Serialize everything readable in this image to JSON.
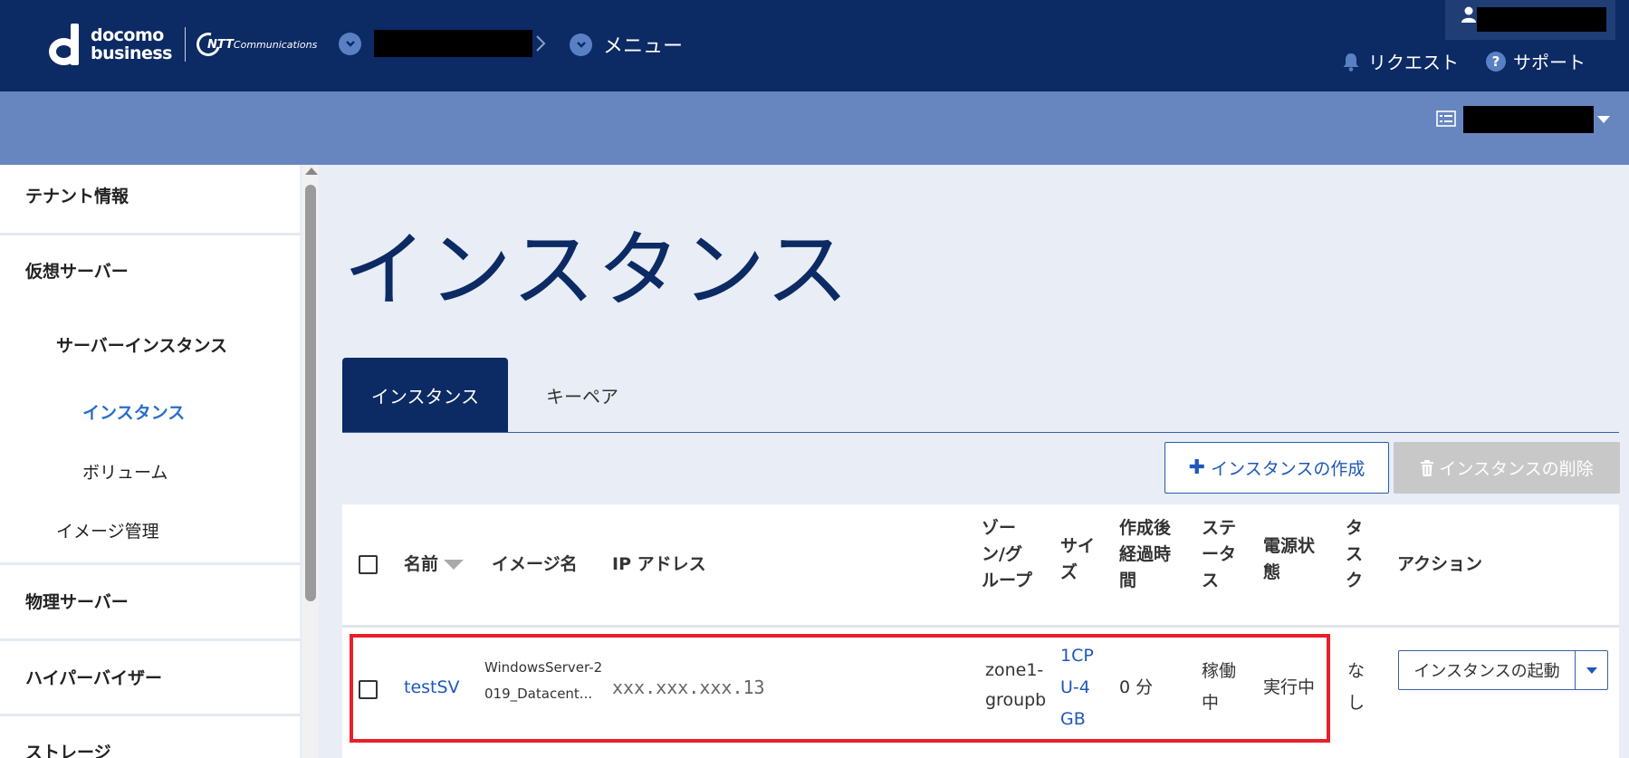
{
  "brand": {
    "logo_top": "docomo",
    "logo_bottom": "business",
    "partner_strong": "NTT",
    "partner_rest": "Communications"
  },
  "header": {
    "menu_label": "メニュー",
    "request_label": "リクエスト",
    "support_label": "サポート"
  },
  "sidebar": {
    "items": [
      {
        "label": "テナント情報"
      },
      {
        "label": "仮想サーバー"
      },
      {
        "label": "サーバーインスタンス"
      },
      {
        "label": "インスタンス"
      },
      {
        "label": "ボリューム"
      },
      {
        "label": "イメージ管理"
      },
      {
        "label": "物理サーバー"
      },
      {
        "label": "ハイパーバイザー"
      },
      {
        "label": "ストレージ"
      }
    ],
    "active_color": "#2a6fc9"
  },
  "main": {
    "title": "インスタンス",
    "tabs": [
      {
        "label": "インスタンス",
        "active": true
      },
      {
        "label": "キーペア",
        "active": false
      }
    ],
    "create_button": "インスタンスの作成",
    "delete_button": "インスタンスの削除"
  },
  "table": {
    "headers": {
      "name": "名前",
      "image": "イメージ名",
      "ip": "IP アドレス",
      "zone_l1": "ゾー",
      "zone_l2": "ン/グ",
      "zone_l3": "ループ",
      "size_l1": "サイ",
      "size_l2": "ズ",
      "age_l1": "作成後",
      "age_l2": "経過時",
      "age_l3": "間",
      "status_l1": "ステ",
      "status_l2": "ータ",
      "status_l3": "ス",
      "power_l1": "電源状",
      "power_l2": "態",
      "task_l1": "タ",
      "task_l2": "ス",
      "task_l3": "ク",
      "action": "アクション"
    },
    "rows": [
      {
        "name": "testSV",
        "image_l1": "WindowsServer-2",
        "image_l2": "019_Datacent...",
        "ip": "xxx.xxx.xxx.13",
        "zone_l1": "zone1-",
        "zone_l2": "groupb",
        "size_l1": "1CP",
        "size_l2": "U-4",
        "size_l3": "GB",
        "age": "0 分",
        "status_l1": "稼働",
        "status_l2": "中",
        "power": "実行中",
        "task_l1": "な",
        "task_l2": "し",
        "action_button": "インスタンスの起動"
      }
    ]
  },
  "colors": {
    "header_bg": "#0c2a63",
    "subbar_bg": "#6786c0",
    "highlight": "#e8202a",
    "link": "#1e58b8"
  }
}
